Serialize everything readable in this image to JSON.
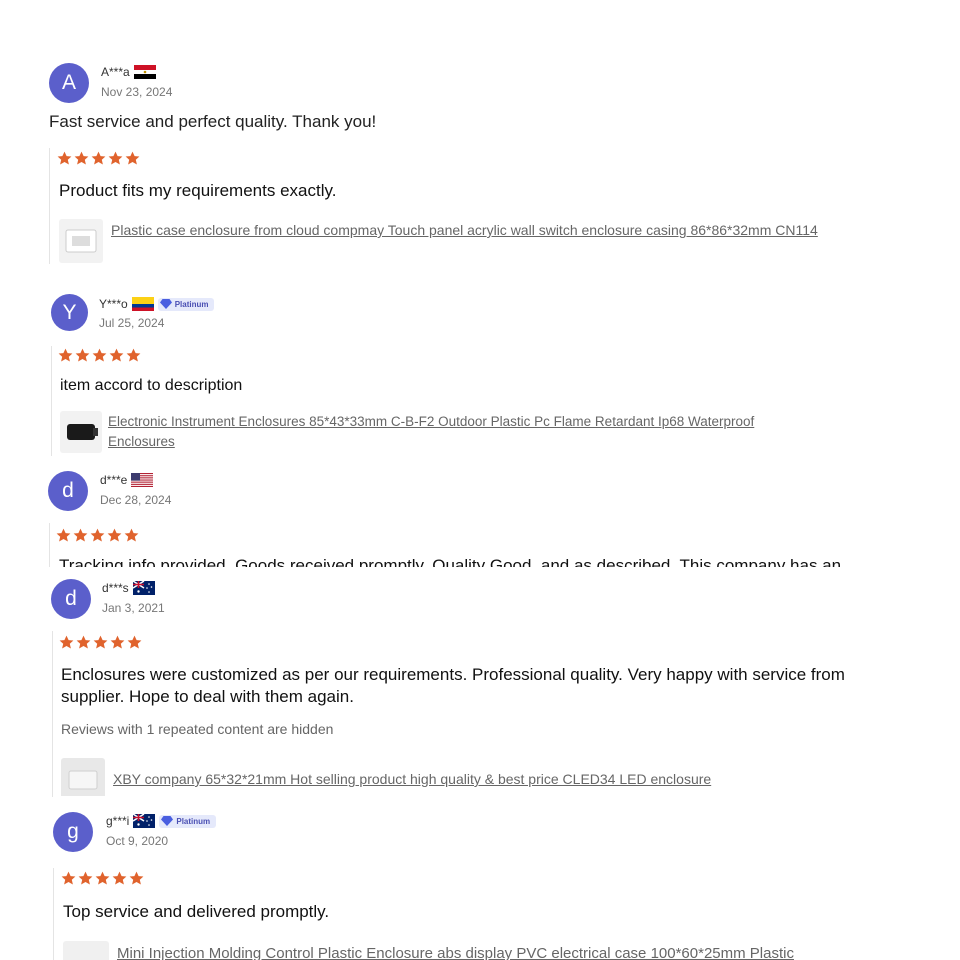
{
  "reviews": [
    {
      "initial": "A",
      "user": "A***a",
      "flag": "egypt",
      "date": "Nov 23, 2024",
      "comment": "Fast service and perfect quality. Thank you!",
      "rating": 5,
      "feedback": "Product fits my requirements exactly.",
      "product": "Plastic case enclosure from cloud compmay Touch panel acrylic wall switch enclosure casing 86*86*32mm CN114"
    },
    {
      "initial": "Y",
      "user": "Y***o",
      "flag": "colombia",
      "badge": "Platinum",
      "date": "Jul 25, 2024",
      "rating": 5,
      "feedback": "item accord to description",
      "product": "Electronic Instrument Enclosures 85*43*33mm C-B-F2 Outdoor Plastic Pc Flame Retardant Ip68 Waterproof Enclosures"
    },
    {
      "initial": "d",
      "user": "d***e",
      "flag": "usa",
      "date": "Dec 28, 2024",
      "rating": 5,
      "feedback": "Tracking info provided. Goods received promptly. Quality Good, and as described. This company has an"
    },
    {
      "initial": "d",
      "user": "d***s",
      "flag": "australia",
      "date": "Jan 3, 2021",
      "rating": 5,
      "feedback": "Enclosures were customized as per our requirements. Professional quality. Very happy with service from supplier. Hope to deal with them again.",
      "hidden_note": "Reviews with 1 repeated content are hidden",
      "product": "XBY company 65*32*21mm Hot selling product high quality & best price CLED34 LED enclosure"
    },
    {
      "initial": "g",
      "user": "g***i",
      "flag": "australia",
      "badge": "Platinum",
      "date": "Oct 9, 2020",
      "rating": 5,
      "feedback": "Top service and delivered promptly.",
      "product": "Mini Injection Molding Control Plastic Enclosure abs display PVC electrical case 100*60*25mm Plastic"
    }
  ],
  "colors": {
    "avatar": "#5b5fcb",
    "star": "#e0632d",
    "badge_bg": "#e5e9fb"
  },
  "icons": [
    "star-icon",
    "platinum-diamond-icon",
    "flag-icon"
  ]
}
